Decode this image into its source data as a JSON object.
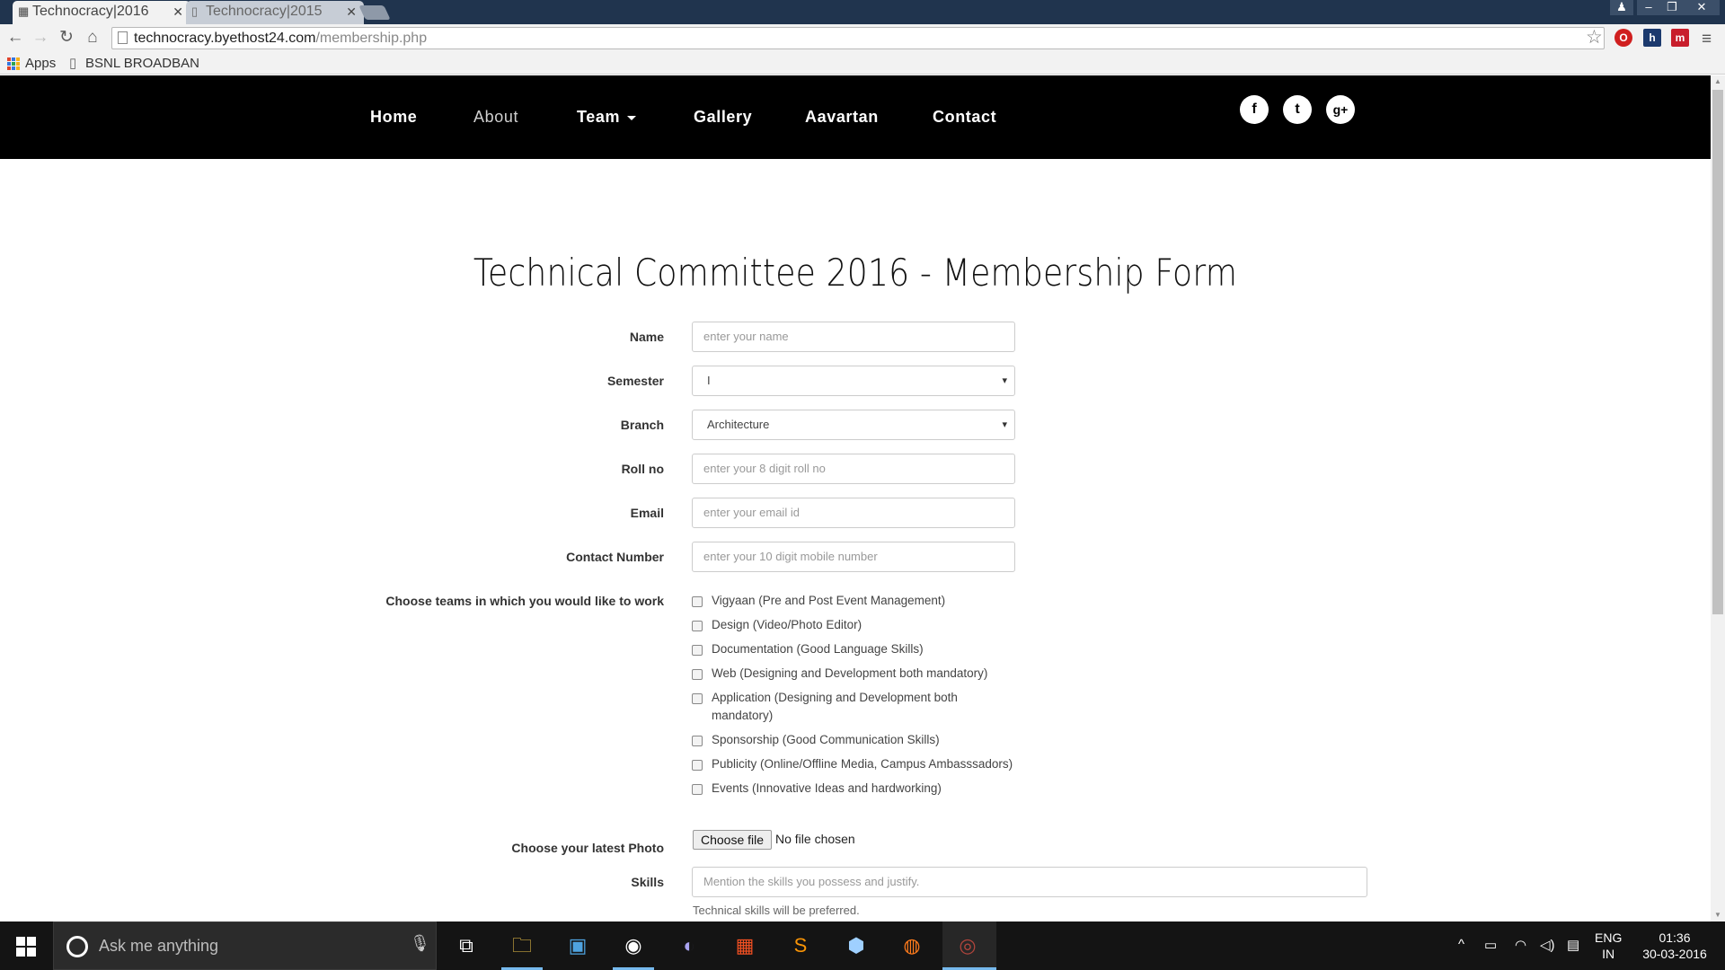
{
  "browser": {
    "tabs": [
      {
        "title": "Technocracy|2016",
        "active": true
      },
      {
        "title": "Technocracy|2015",
        "active": false
      }
    ],
    "url_domain": "technocracy.byethost24.com",
    "url_path": "/membership.php",
    "bookmarks": [
      "Apps",
      "BSNL BROADBAN"
    ]
  },
  "site": {
    "nav": [
      "Home",
      "About",
      "Team",
      "Gallery",
      "Aavartan",
      "Contact"
    ],
    "social": [
      {
        "icon": "facebook-icon",
        "glyph": "f"
      },
      {
        "icon": "twitter-icon",
        "glyph": "t"
      },
      {
        "icon": "google-plus-icon",
        "glyph": "g+"
      }
    ]
  },
  "form": {
    "title": "Technical Committee 2016 - Membership Form",
    "name_label": "Name",
    "name_placeholder": "enter your name",
    "semester_label": "Semester",
    "semester_value": "I",
    "branch_label": "Branch",
    "branch_value": "Architecture",
    "roll_label": "Roll no",
    "roll_placeholder": "enter your 8 digit roll no",
    "email_label": "Email",
    "email_placeholder": "enter your email id",
    "contact_label": "Contact Number",
    "contact_placeholder": "enter your 10 digit mobile number",
    "teams_label": "Choose teams in which you would like to work",
    "teams": [
      "Vigyaan (Pre and Post Event Management)",
      "Design (Video/Photo Editor)",
      "Documentation (Good Language Skills)",
      "Web (Designing and Development both mandatory)",
      "Application (Designing and Development both mandatory)",
      "Sponsorship (Good Communication Skills)",
      "Publicity (Online/Offline Media, Campus Ambasssadors)",
      "Events (Innovative Ideas and hardworking)"
    ],
    "photo_label": "Choose your latest Photo",
    "file_button": "Choose file",
    "file_status": "No file chosen",
    "skills_label": "Skills",
    "skills_placeholder": "Mention the skills you possess and justify.",
    "skills_help": "Technical skills will be preferred."
  },
  "taskbar": {
    "search_placeholder": "Ask me anything",
    "lang_line1": "ENG",
    "lang_line2": "IN",
    "time": "01:36",
    "date": "30-03-2016"
  },
  "colors": {
    "tabstrip": "#20344e",
    "nav_bg": "#000000",
    "taskbar": "#141414"
  }
}
